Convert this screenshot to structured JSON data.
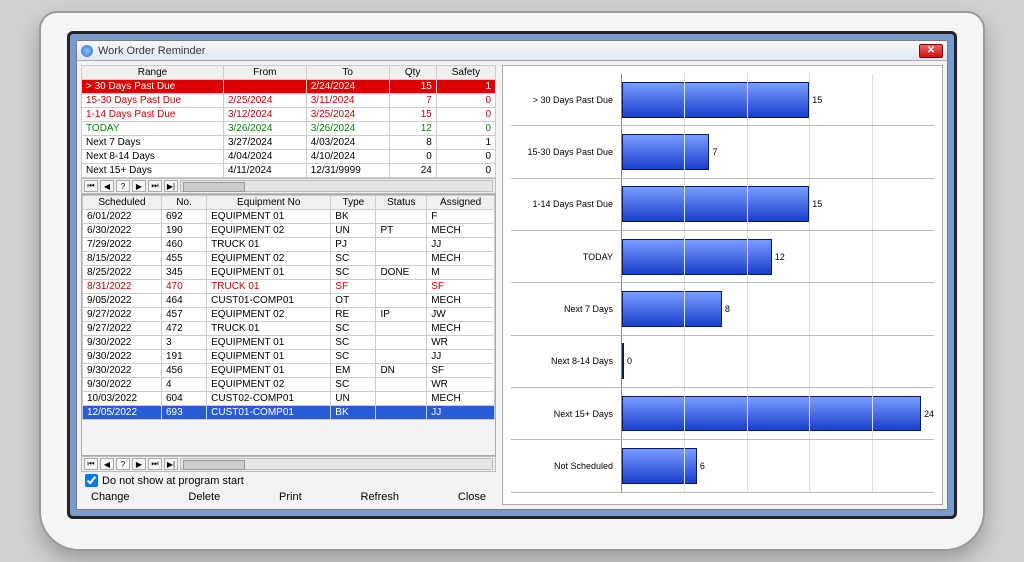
{
  "window": {
    "title": "Work Order Reminder"
  },
  "range_table": {
    "headers": [
      "Range",
      "From",
      "To",
      "Qty",
      "Safety"
    ],
    "rows": [
      {
        "range": "> 30 Days Past Due",
        "from": "",
        "to": "2/24/2024",
        "qty": 15,
        "safety": 1,
        "style": "row-red"
      },
      {
        "range": "15-30 Days Past Due",
        "from": "2/25/2024",
        "to": "3/11/2024",
        "qty": 7,
        "safety": 0,
        "style": "text-red"
      },
      {
        "range": "1-14 Days Past Due",
        "from": "3/12/2024",
        "to": "3/25/2024",
        "qty": 15,
        "safety": 0,
        "style": "text-red"
      },
      {
        "range": "TODAY",
        "from": "3/26/2024",
        "to": "3/26/2024",
        "qty": 12,
        "safety": 0,
        "style": "text-green"
      },
      {
        "range": "Next 7 Days",
        "from": "3/27/2024",
        "to": "4/03/2024",
        "qty": 8,
        "safety": 1,
        "style": ""
      },
      {
        "range": "Next 8-14 Days",
        "from": "4/04/2024",
        "to": "4/10/2024",
        "qty": 0,
        "safety": 0,
        "style": ""
      },
      {
        "range": "Next 15+ Days",
        "from": "4/11/2024",
        "to": "12/31/9999",
        "qty": 24,
        "safety": 0,
        "style": ""
      }
    ]
  },
  "details_table": {
    "headers": [
      "Scheduled",
      "No.",
      "Equipment No",
      "Type",
      "Status",
      "Assigned"
    ],
    "rows": [
      {
        "scheduled": "6/01/2022",
        "no": "692",
        "equip": "EQUIPMENT 01",
        "type": "BK",
        "status": "",
        "assigned": "F",
        "style": ""
      },
      {
        "scheduled": "6/30/2022",
        "no": "190",
        "equip": "EQUIPMENT 02",
        "type": "UN",
        "status": "PT",
        "assigned": "MECH",
        "style": ""
      },
      {
        "scheduled": "7/29/2022",
        "no": "460",
        "equip": "TRUCK 01",
        "type": "PJ",
        "status": "",
        "assigned": "JJ",
        "style": ""
      },
      {
        "scheduled": "8/15/2022",
        "no": "455",
        "equip": "EQUIPMENT 02",
        "type": "SC",
        "status": "",
        "assigned": "MECH",
        "style": ""
      },
      {
        "scheduled": "8/25/2022",
        "no": "345",
        "equip": "EQUIPMENT 01",
        "type": "SC",
        "status": "DONE",
        "assigned": "M",
        "style": ""
      },
      {
        "scheduled": "8/31/2022",
        "no": "470",
        "equip": "TRUCK 01",
        "type": "SF",
        "status": "",
        "assigned": "SF",
        "style": "text-red"
      },
      {
        "scheduled": "9/05/2022",
        "no": "464",
        "equip": "CUST01-COMP01",
        "type": "OT",
        "status": "",
        "assigned": "MECH",
        "style": ""
      },
      {
        "scheduled": "9/27/2022",
        "no": "457",
        "equip": "EQUIPMENT 02",
        "type": "RE",
        "status": "IP",
        "assigned": "JW",
        "style": ""
      },
      {
        "scheduled": "9/27/2022",
        "no": "472",
        "equip": "TRUCK 01",
        "type": "SC",
        "status": "",
        "assigned": "MECH",
        "style": ""
      },
      {
        "scheduled": "9/30/2022",
        "no": "3",
        "equip": "EQUIPMENT 01",
        "type": "SC",
        "status": "",
        "assigned": "WR",
        "style": ""
      },
      {
        "scheduled": "9/30/2022",
        "no": "191",
        "equip": "EQUIPMENT 01",
        "type": "SC",
        "status": "",
        "assigned": "JJ",
        "style": ""
      },
      {
        "scheduled": "9/30/2022",
        "no": "456",
        "equip": "EQUIPMENT 01",
        "type": "EM",
        "status": "DN",
        "assigned": "SF",
        "style": ""
      },
      {
        "scheduled": "9/30/2022",
        "no": "4",
        "equip": "EQUIPMENT 02",
        "type": "SC",
        "status": "",
        "assigned": "WR",
        "style": ""
      },
      {
        "scheduled": "10/03/2022",
        "no": "604",
        "equip": "CUST02-COMP01",
        "type": "UN",
        "status": "",
        "assigned": "MECH",
        "style": ""
      },
      {
        "scheduled": "12/05/2022",
        "no": "693",
        "equip": "CUST01-COMP01",
        "type": "BK",
        "status": "",
        "assigned": "JJ",
        "style": "row-sel"
      }
    ]
  },
  "checkbox_label": "Do not show at program start",
  "buttons": {
    "change": "Change",
    "delete": "Delete",
    "print": "Print",
    "refresh": "Refresh",
    "close": "Close"
  },
  "chart_data": {
    "type": "bar",
    "orientation": "horizontal",
    "categories": [
      "> 30 Days Past Due",
      "15-30 Days Past Due",
      "1-14 Days Past Due",
      "TODAY",
      "Next 7 Days",
      "Next 8-14 Days",
      "Next 15+ Days",
      "Not Scheduled"
    ],
    "values": [
      15,
      7,
      15,
      12,
      8,
      0,
      24,
      6
    ],
    "xlim": [
      0,
      25
    ]
  }
}
